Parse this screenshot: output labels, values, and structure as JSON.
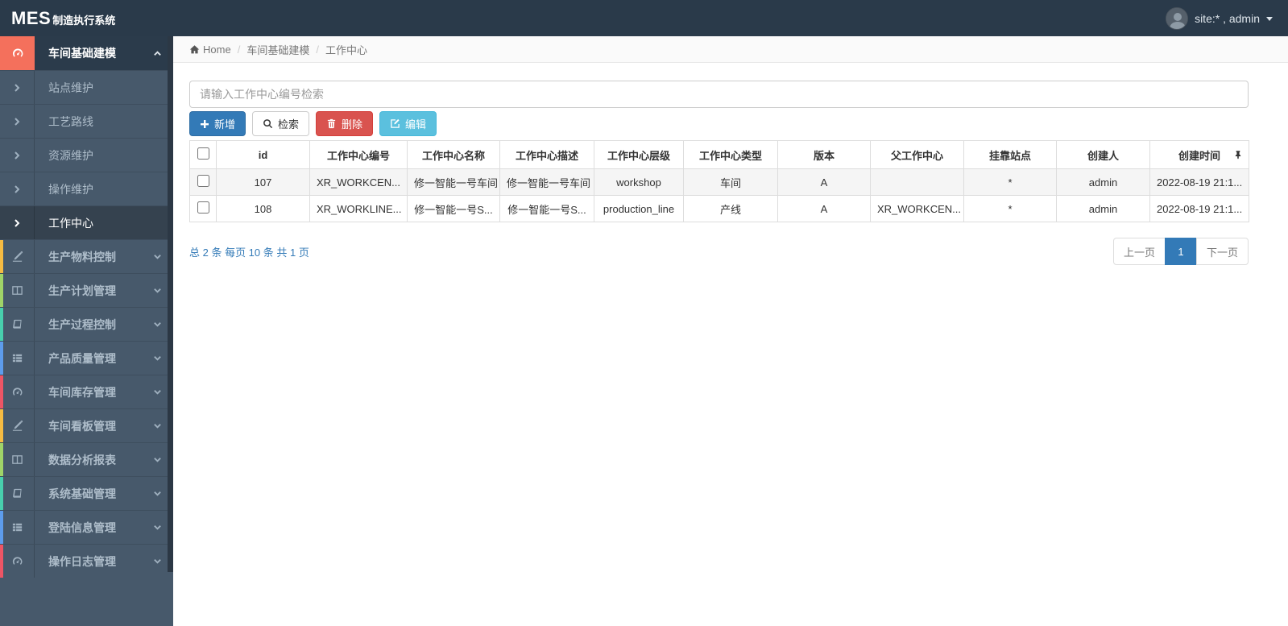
{
  "topbar": {
    "logo_mes": "MES",
    "logo_suffix": "制造执行系统",
    "user_label": "site:* , admin"
  },
  "sidebar": {
    "items": [
      {
        "label": "车间基础建模",
        "icon": "tachometer-icon",
        "state": "active-expanded",
        "accent": "#f4705c"
      },
      {
        "label": "站点维护",
        "icon": "chevron-right-icon",
        "type": "sub"
      },
      {
        "label": "工艺路线",
        "icon": "chevron-right-icon",
        "type": "sub"
      },
      {
        "label": "资源维护",
        "icon": "chevron-right-icon",
        "type": "sub"
      },
      {
        "label": "操作维护",
        "icon": "chevron-right-icon",
        "type": "sub"
      },
      {
        "label": "工作中心",
        "icon": "chevron-right-icon",
        "type": "sub",
        "state": "selected"
      },
      {
        "label": "生产物料控制",
        "icon": "pencil-icon",
        "accent": "#f6bb42"
      },
      {
        "label": "生产计划管理",
        "icon": "columns-icon",
        "accent": "#a0d468"
      },
      {
        "label": "生产过程控制",
        "icon": "book-icon",
        "accent": "#48cfad"
      },
      {
        "label": "产品质量管理",
        "icon": "list-icon",
        "accent": "#5d9cec"
      },
      {
        "label": "车间库存管理",
        "icon": "tachometer-icon",
        "accent": "#ed5565"
      },
      {
        "label": "车间看板管理",
        "icon": "pencil-icon",
        "accent": "#f6bb42"
      },
      {
        "label": "数据分析报表",
        "icon": "columns-icon",
        "accent": "#a0d468"
      },
      {
        "label": "系统基础管理",
        "icon": "book-icon",
        "accent": "#48cfad"
      },
      {
        "label": "登陆信息管理",
        "icon": "list-icon",
        "accent": "#5d9cec"
      },
      {
        "label": "操作日志管理",
        "icon": "tachometer-icon",
        "accent": "#ed5565"
      }
    ]
  },
  "breadcrumb": {
    "home": "Home",
    "separator": "/",
    "section": "车间基础建模",
    "current": "工作中心"
  },
  "search": {
    "placeholder": "请输入工作中心编号检索",
    "value": ""
  },
  "toolbar": {
    "add_label": "新增",
    "search_label": "检索",
    "delete_label": "删除",
    "edit_label": "编辑"
  },
  "table": {
    "columns": [
      "id",
      "工作中心编号",
      "工作中心名称",
      "工作中心描述",
      "工作中心层级",
      "工作中心类型",
      "版本",
      "父工作中心",
      "挂靠站点",
      "创建人",
      "创建时间"
    ],
    "rows": [
      {
        "cells": [
          "107",
          "XR_WORKCEN...",
          "修一智能一号车间",
          "修一智能一号车间",
          "workshop",
          "车间",
          "A",
          "",
          "*",
          "admin",
          "2022-08-19 21:1..."
        ]
      },
      {
        "cells": [
          "108",
          "XR_WORKLINE...",
          "修一智能一号S...",
          "修一智能一号S...",
          "production_line",
          "产线",
          "A",
          "XR_WORKCEN...",
          "*",
          "admin",
          "2022-08-19 21:1..."
        ]
      }
    ]
  },
  "pagination": {
    "summary": "总 2 条  每页 10 条  共 1 页",
    "prev_label": "上一页",
    "current_page": "1",
    "next_label": "下一页"
  },
  "colors": {
    "topbar_bg": "#2a3a4a",
    "sidebar_bg": "#47596b",
    "active_item_accent": "#f4705c",
    "primary_button": "#337ab7",
    "danger_button": "#d9534f",
    "info_button": "#5bc0de",
    "pagination_active": "#337ab7"
  }
}
